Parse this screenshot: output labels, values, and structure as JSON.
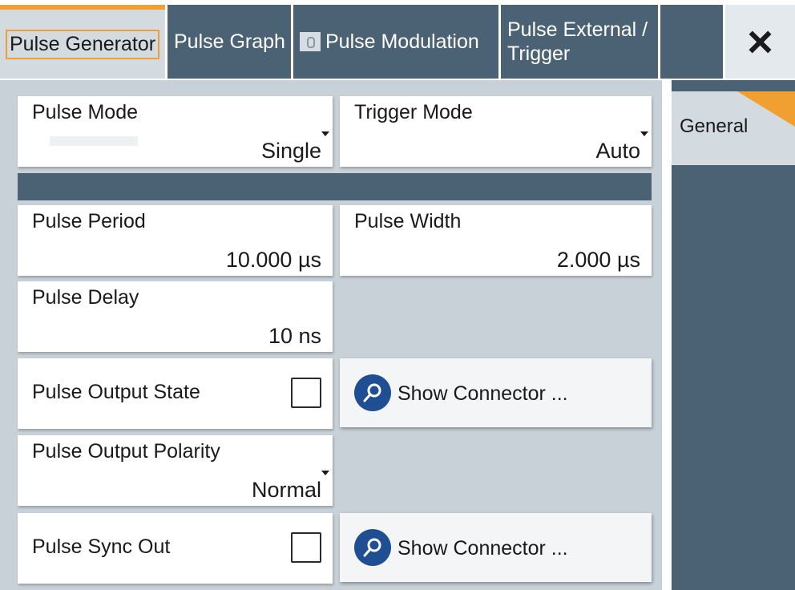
{
  "tabs": [
    {
      "label": "Pulse Generator"
    },
    {
      "label": "Pulse Graph"
    },
    {
      "label": "Pulse Modulation"
    },
    {
      "label": "Pulse External / Trigger"
    }
  ],
  "close_icon": "×",
  "side_tabs": [
    {
      "label": "General"
    }
  ],
  "fields": {
    "pulse_mode": {
      "label": "Pulse Mode",
      "value": "Single"
    },
    "trigger_mode": {
      "label": "Trigger Mode",
      "value": "Auto"
    },
    "pulse_period": {
      "label": "Pulse Period",
      "value": "10.000 µs"
    },
    "pulse_width": {
      "label": "Pulse Width",
      "value": "2.000 µs"
    },
    "pulse_delay": {
      "label": "Pulse Delay",
      "value": "10 ns"
    },
    "pulse_output_state": {
      "label": "Pulse Output State",
      "checked": false
    },
    "pulse_output_polarity": {
      "label": "Pulse Output Polarity",
      "value": "Normal"
    },
    "pulse_sync_out": {
      "label": "Pulse Sync Out",
      "checked": false
    }
  },
  "buttons": {
    "show_connector_1": {
      "label": "Show Connector ...",
      "icon": "search-icon"
    },
    "show_connector_2": {
      "label": "Show Connector ...",
      "icon": "search-icon"
    }
  },
  "colors": {
    "accent": "#f0a030",
    "tab_bg": "#4a6273",
    "active_tab_bg": "#d3dbe1",
    "panel_bg": "#c8d1d8",
    "icon_blue": "#1f4f92"
  }
}
